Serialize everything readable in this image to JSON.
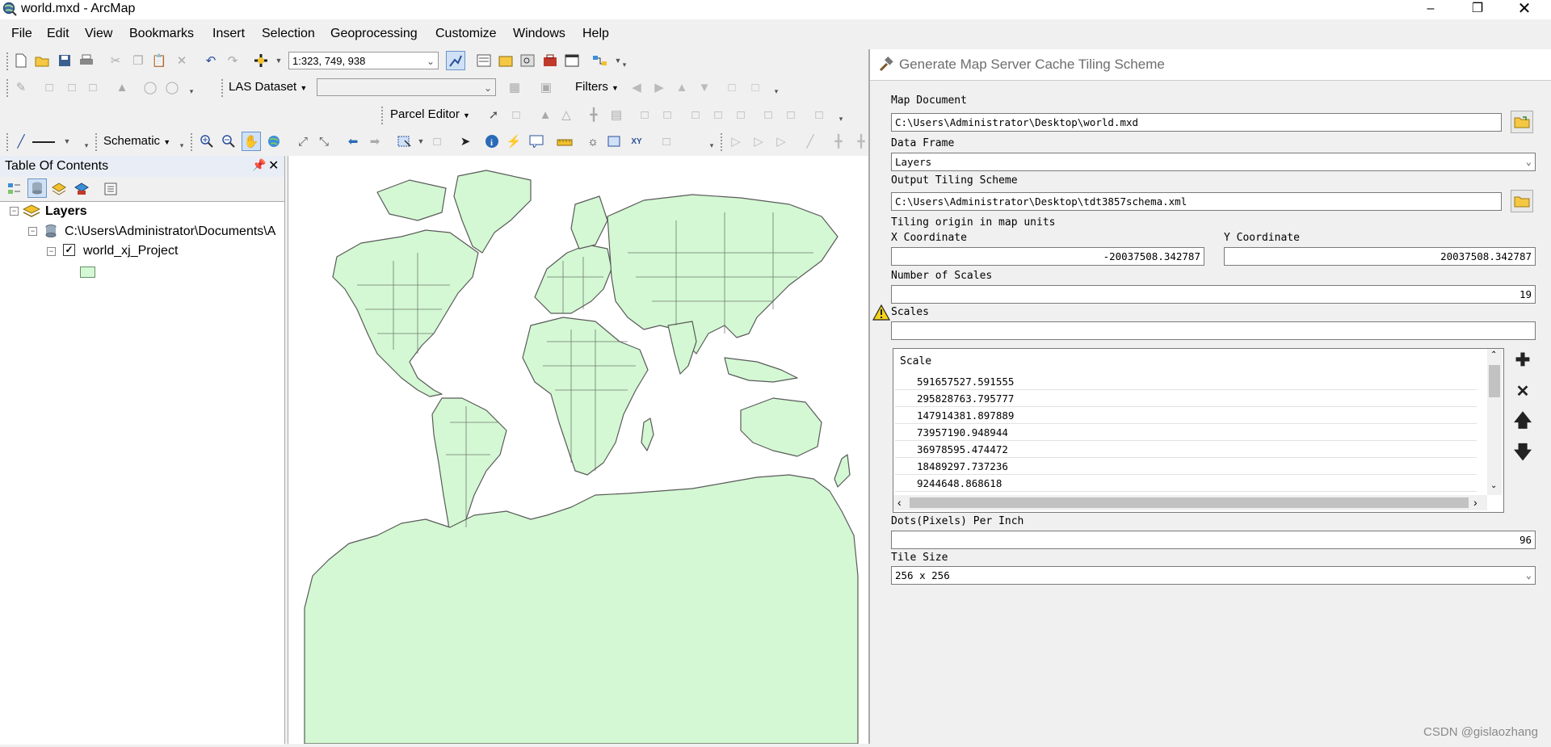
{
  "window": {
    "title": "world.mxd - ArcMap",
    "controls": [
      "minimize",
      "restore",
      "close"
    ]
  },
  "menu": [
    "File",
    "Edit",
    "View",
    "Bookmarks",
    "Insert",
    "Selection",
    "Geoprocessing",
    "Customize",
    "Windows",
    "Help"
  ],
  "toolbar": {
    "scale_value": "1:323, 749, 938",
    "las_dataset_label": "LAS Dataset",
    "filters_label": "Filters",
    "parcel_editor_label": "Parcel Editor",
    "schematic_label": "Schematic"
  },
  "toc": {
    "title": "Table Of Contents",
    "root_label": "Layers",
    "source_path": "C:\\Users\\Administrator\\Documents\\A",
    "layer_name": "world_xj_Project",
    "layer_checked": true,
    "symbol_fill": "#d3f8d3"
  },
  "map": {
    "land_fill": "#d3f8d3",
    "border_color": "#5a5a5a"
  },
  "dialog": {
    "title": "Generate Map Server Cache Tiling Scheme",
    "map_document_label": "Map Document",
    "map_document_value": "C:\\Users\\Administrator\\Desktop\\world.mxd",
    "data_frame_label": "Data Frame",
    "data_frame_value": "Layers",
    "output_label": "Output Tiling Scheme",
    "output_value": "C:\\Users\\Administrator\\Desktop\\tdt3857schema.xml",
    "origin_label": "Tiling origin in map units",
    "x_label": "X Coordinate",
    "x_value": "-20037508.342787",
    "y_label": "Y Coordinate",
    "y_value": "20037508.342787",
    "num_scales_label": "Number of Scales",
    "num_scales_value": "19",
    "scales_label": "Scales",
    "scales_input_value": "",
    "scale_column_header": "Scale",
    "scale_rows": [
      "591657527.591555",
      "295828763.795777",
      "147914381.897889",
      "73957190.948944",
      "36978595.474472",
      "18489297.737236",
      "9244648.868618"
    ],
    "dpi_label": "Dots(Pixels) Per Inch",
    "dpi_value": "96",
    "tile_size_label": "Tile Size",
    "tile_size_value": "256 x 256"
  },
  "watermark": "CSDN @gislaozhang"
}
